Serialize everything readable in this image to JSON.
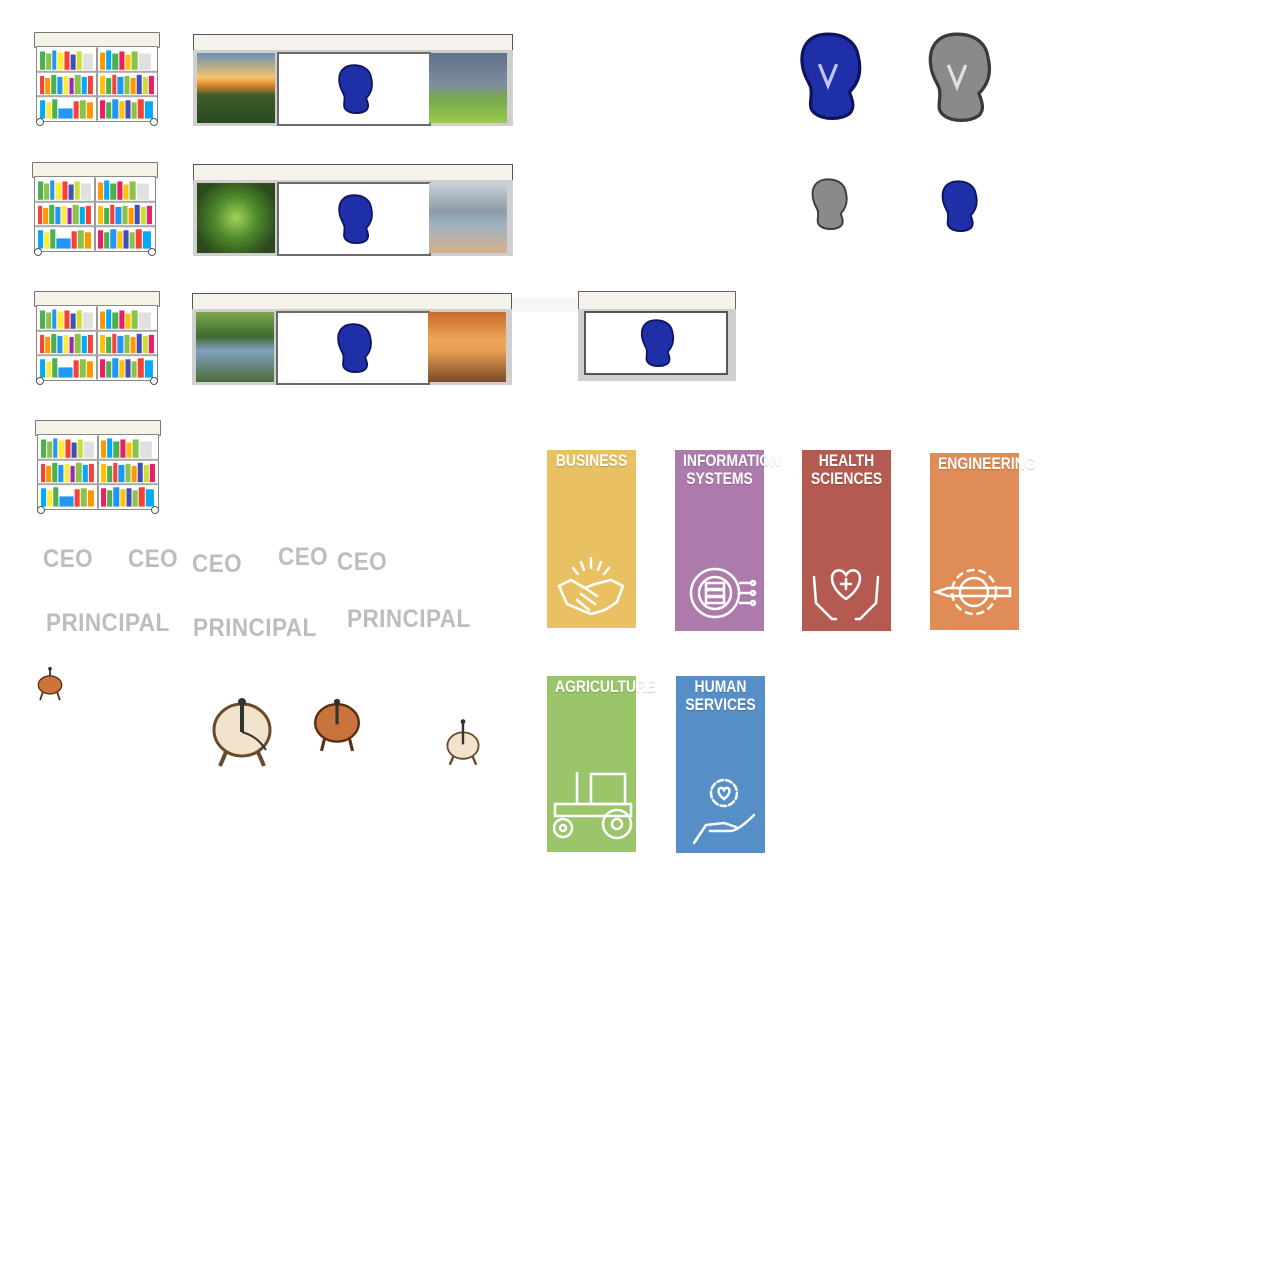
{
  "colors": {
    "cobra_blue": "#1f2fa8",
    "cobra_gray": "#7a7a7a",
    "title_gray": "#bdbdbd",
    "business": "#e9c162",
    "information_systems": "#ad7bab",
    "health_sciences": "#b55a50",
    "engineering": "#df8c56",
    "agriculture": "#9bc56a",
    "human_services": "#568fc7"
  },
  "assets": {
    "bookshelves": [
      "bookshelf-1",
      "bookshelf-2",
      "bookshelf-3",
      "bookshelf-4"
    ],
    "panels": [
      "panel-sunset-rainbow",
      "panel-sprouts-lake",
      "panel-river-autumn"
    ],
    "cobra_logos": [
      "cobra-blue-large",
      "cobra-gray-large",
      "cobra-gray-small",
      "cobra-blue-small"
    ],
    "stools": [
      "stool-tiny",
      "stool-light-large",
      "stool-wood-medium",
      "stool-light-small"
    ]
  },
  "titles": {
    "ceo": [
      "CEO",
      "CEO",
      "CEO",
      "CEO",
      "CEO"
    ],
    "principal": [
      "PRINCIPAL",
      "PRINCIPAL",
      "PRINCIPAL"
    ]
  },
  "cards": [
    {
      "label_1": "BUSINESS",
      "label_2": "",
      "icon": "handshake-icon"
    },
    {
      "label_1": "INFORMATION",
      "label_2": "SYSTEMS",
      "icon": "gear-server-icon"
    },
    {
      "label_1": "HEALTH",
      "label_2": "SCIENCES",
      "icon": "heart-hands-icon"
    },
    {
      "label_1": "ENGINEERING",
      "label_2": "",
      "icon": "gear-pencil-icon"
    },
    {
      "label_1": "AGRICULTURE",
      "label_2": "",
      "icon": "tractor-icon"
    },
    {
      "label_1": "HUMAN",
      "label_2": "SERVICES",
      "icon": "hand-gear-icon"
    }
  ]
}
